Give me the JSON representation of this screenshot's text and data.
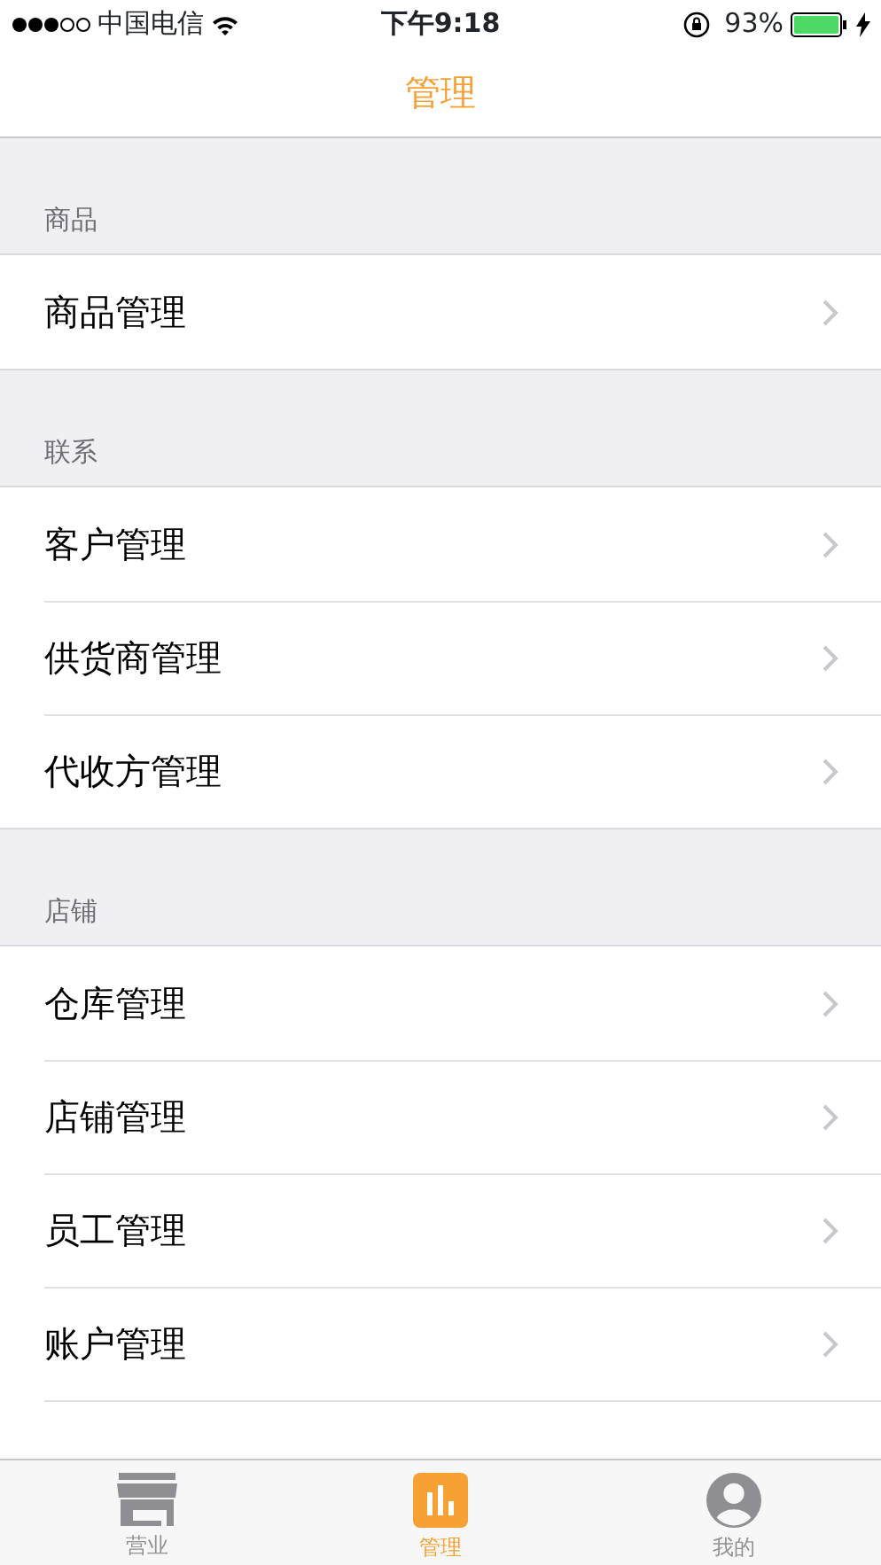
{
  "status_bar": {
    "carrier": "中国电信",
    "time": "下午9:18",
    "battery": "93%"
  },
  "nav_bar": {
    "title": "管理"
  },
  "sections": [
    {
      "header": "商品",
      "items": [
        {
          "label": "商品管理"
        }
      ]
    },
    {
      "header": "联系",
      "items": [
        {
          "label": "客户管理"
        },
        {
          "label": "供货商管理"
        },
        {
          "label": "代收方管理"
        }
      ]
    },
    {
      "header": "店铺",
      "items": [
        {
          "label": "仓库管理"
        },
        {
          "label": "店铺管理"
        },
        {
          "label": "员工管理"
        },
        {
          "label": "账户管理"
        }
      ]
    }
  ],
  "tab_bar": [
    {
      "kind": "store",
      "label": "营业",
      "selected": false
    },
    {
      "kind": "chart",
      "label": "管理",
      "selected": true
    },
    {
      "kind": "person",
      "label": "我的",
      "selected": false
    }
  ]
}
